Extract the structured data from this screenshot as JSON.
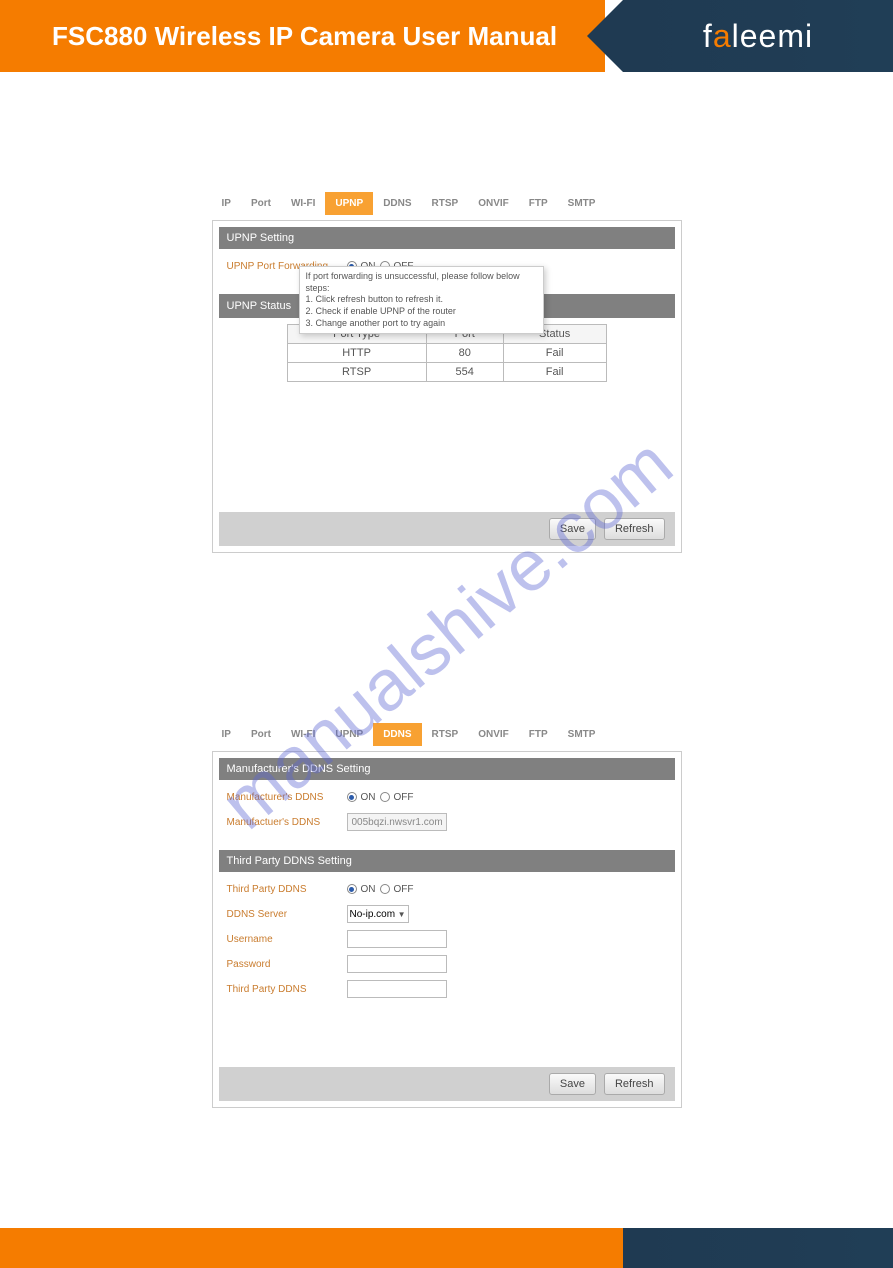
{
  "header": {
    "title": "FSC880 Wireless IP Camera User Manual",
    "logo_pre": "f",
    "logo_mid": "a",
    "logo_post": "leemi"
  },
  "watermark": "manualshive.com",
  "tabs": [
    "IP",
    "Port",
    "WI-FI",
    "UPNP",
    "DDNS",
    "RTSP",
    "ONVIF",
    "FTP",
    "SMTP"
  ],
  "panel1": {
    "active_tab": "UPNP",
    "section1_title": "UPNP Setting",
    "upnp_forward_label": "UPNP Port Forwarding",
    "on_label": "ON",
    "off_label": "OFF",
    "section2_title": "UPNP Status",
    "tooltip": {
      "l0": "If port forwarding is unsuccessful, please follow below steps:",
      "l1": "1. Click refresh button to refresh it.",
      "l2": "2. Check if enable UPNP of the router",
      "l3": "3. Change another port to try again"
    },
    "table": {
      "h1": "Port Type",
      "h2": "Port",
      "h3": "Status",
      "rows": [
        {
          "type": "HTTP",
          "port": "80",
          "status": "Fail"
        },
        {
          "type": "RTSP",
          "port": "554",
          "status": "Fail"
        }
      ]
    },
    "save": "Save",
    "refresh": "Refresh"
  },
  "panel2": {
    "active_tab": "DDNS",
    "section1_title": "Manufacturer's DDNS Setting",
    "mfg_ddns_label": "Manufacturer's DDNS",
    "mfg_ddns_field_label": "Manufactuer's DDNS",
    "mfg_ddns_value": "005bqzi.nwsvr1.com",
    "on_label": "ON",
    "off_label": "OFF",
    "section2_title": "Third Party DDNS Setting",
    "tp_ddns_label": "Third Party DDNS",
    "ddns_server_label": "DDNS Server",
    "ddns_server_value": "No-ip.com",
    "username_label": "Username",
    "password_label": "Password",
    "tp_ddns_field_label": "Third Party DDNS",
    "save": "Save",
    "refresh": "Refresh"
  }
}
